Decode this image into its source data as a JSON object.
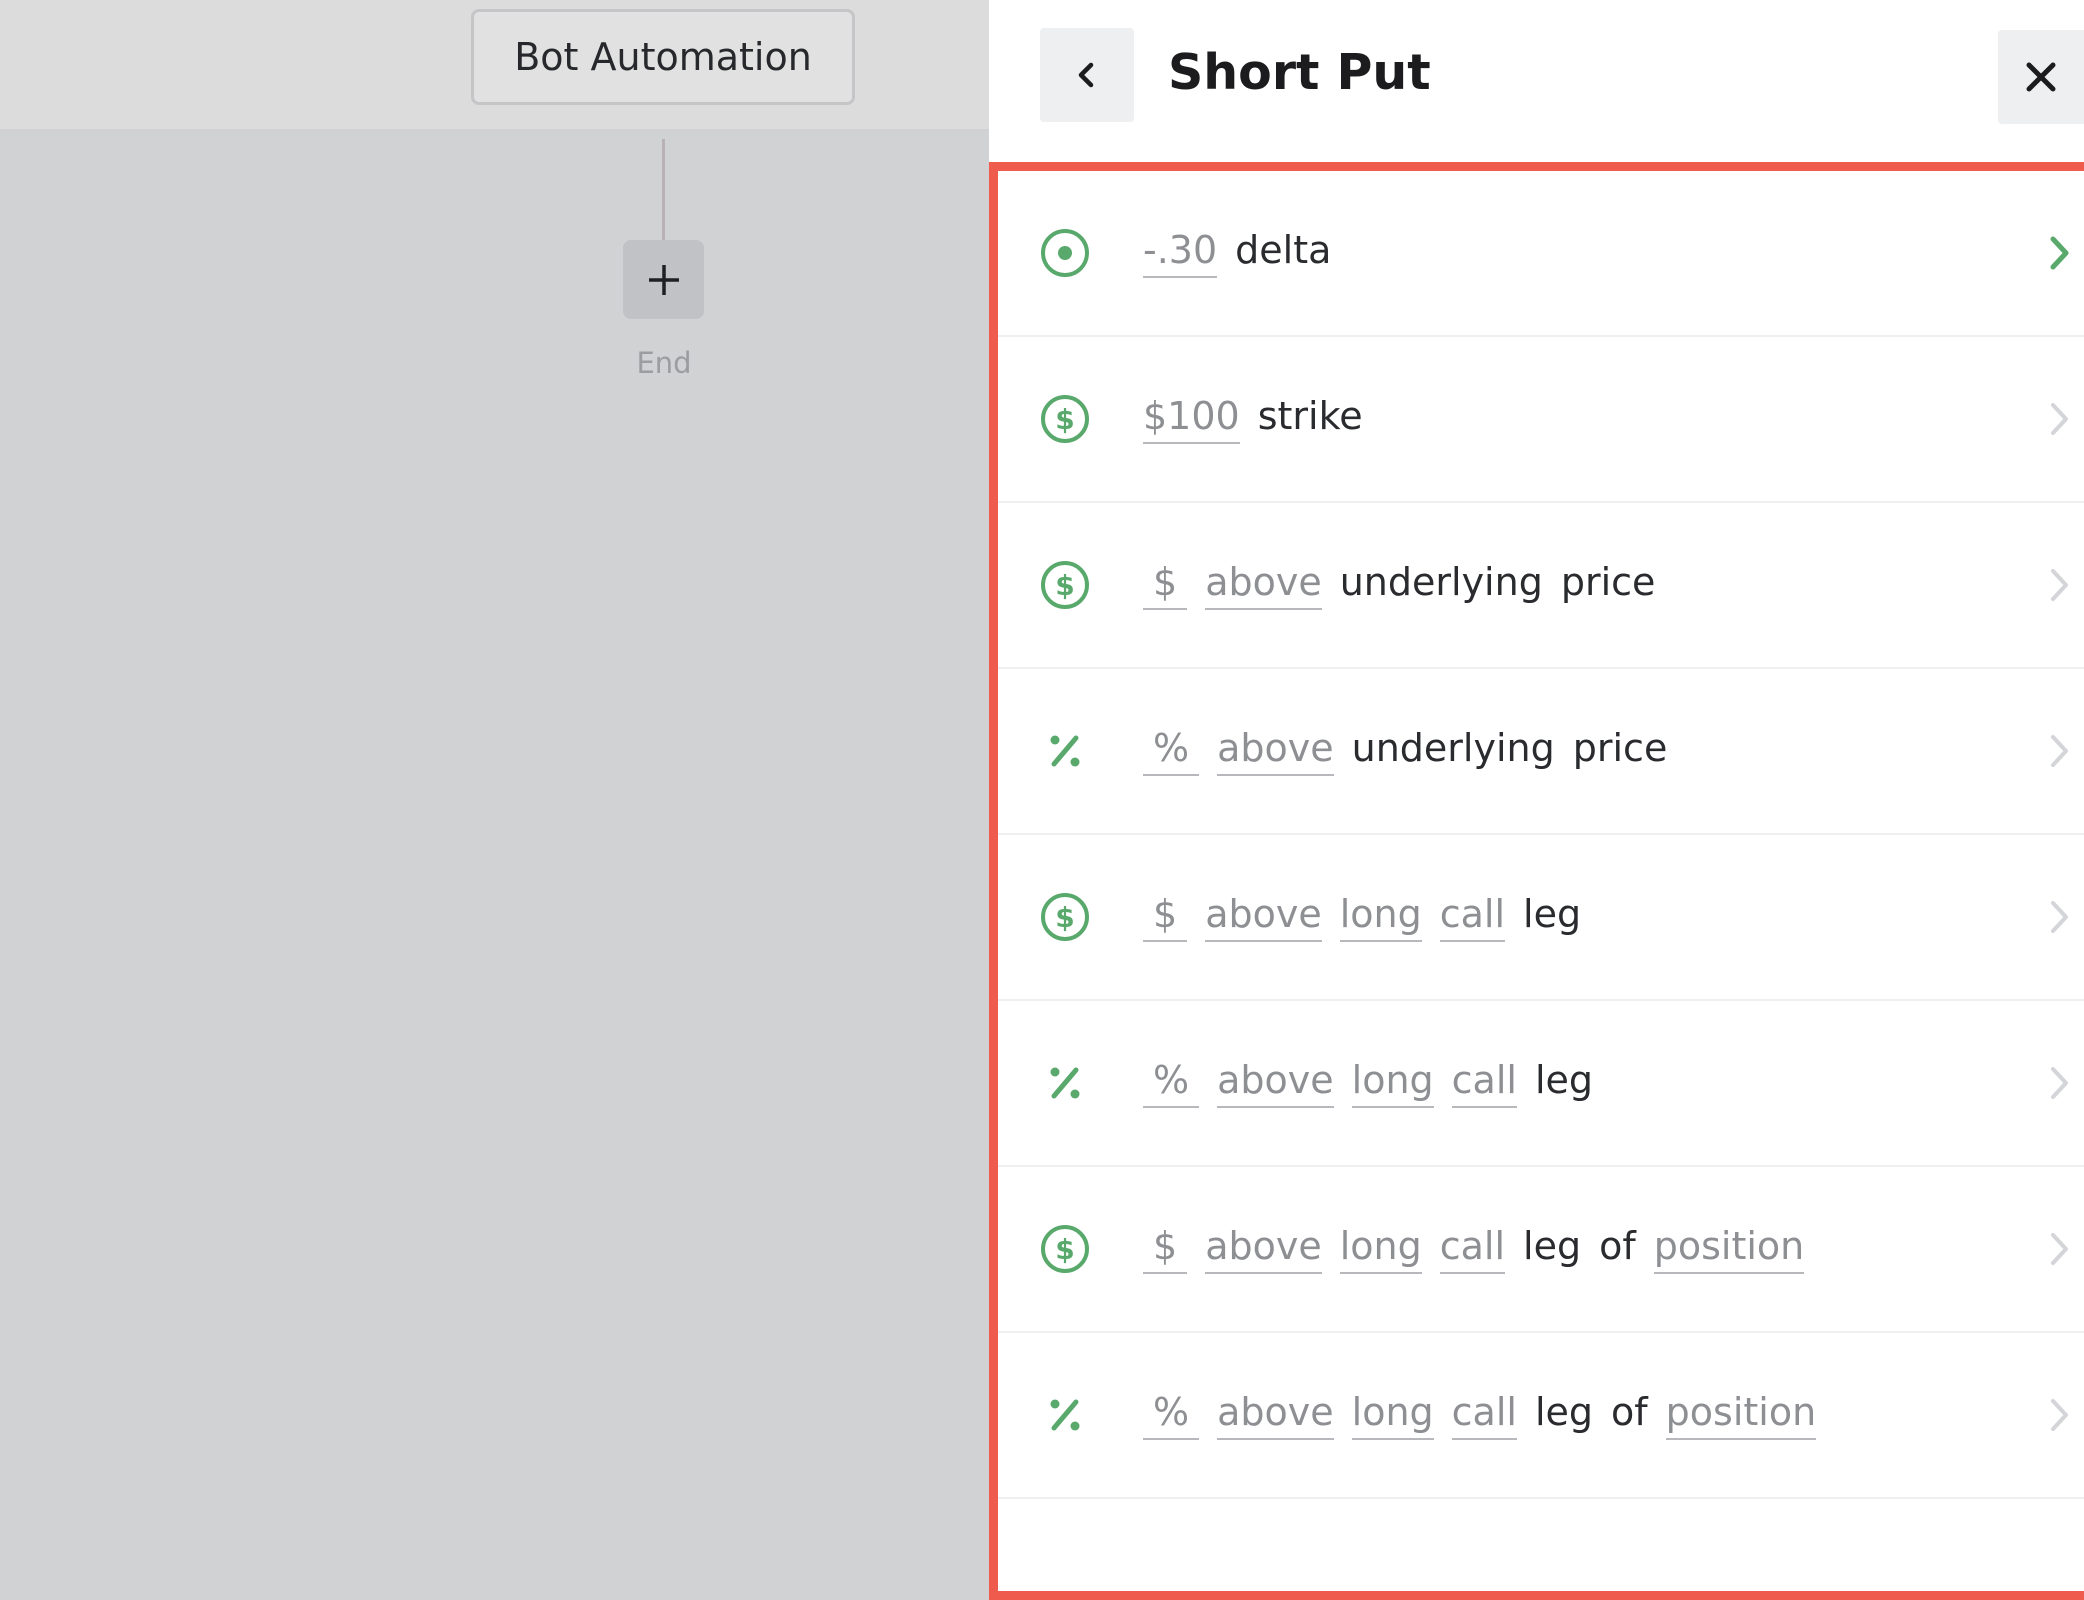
{
  "canvas": {
    "bot_node_label": "Bot Automation",
    "add_icon": "plus-icon",
    "end_label": "End"
  },
  "panel": {
    "title": "Short Put",
    "back_icon": "chevron-left-icon",
    "close_icon": "close-icon",
    "highlight_color": "#ef5b4d",
    "accent_color": "#5aa96c",
    "options": [
      {
        "icon": "target-icon",
        "field1": "-.30",
        "text1": "delta",
        "active": true
      },
      {
        "icon": "dollar-circle-icon",
        "field1": "$100",
        "text1": "strike"
      },
      {
        "icon": "dollar-circle-icon",
        "field1": "$",
        "field2": "above",
        "text1": "underlying",
        "text2": "price"
      },
      {
        "icon": "percent-icon",
        "field1": "%",
        "field2": "above",
        "text1": "underlying",
        "text2": "price"
      },
      {
        "icon": "dollar-circle-icon",
        "field1": "$",
        "field2": "above",
        "field3": "long",
        "field4": "call",
        "text1": "leg"
      },
      {
        "icon": "percent-icon",
        "field1": "%",
        "field2": "above",
        "field3": "long",
        "field4": "call",
        "text1": "leg"
      },
      {
        "icon": "dollar-circle-icon",
        "field1": "$",
        "field2": "above",
        "field3": "long",
        "field4": "call",
        "text1": "leg",
        "text2": "of",
        "field5": "position"
      },
      {
        "icon": "percent-icon",
        "field1": "%",
        "field2": "above",
        "field3": "long",
        "field4": "call",
        "text1": "leg",
        "text2": "of",
        "field5": "position"
      }
    ]
  }
}
